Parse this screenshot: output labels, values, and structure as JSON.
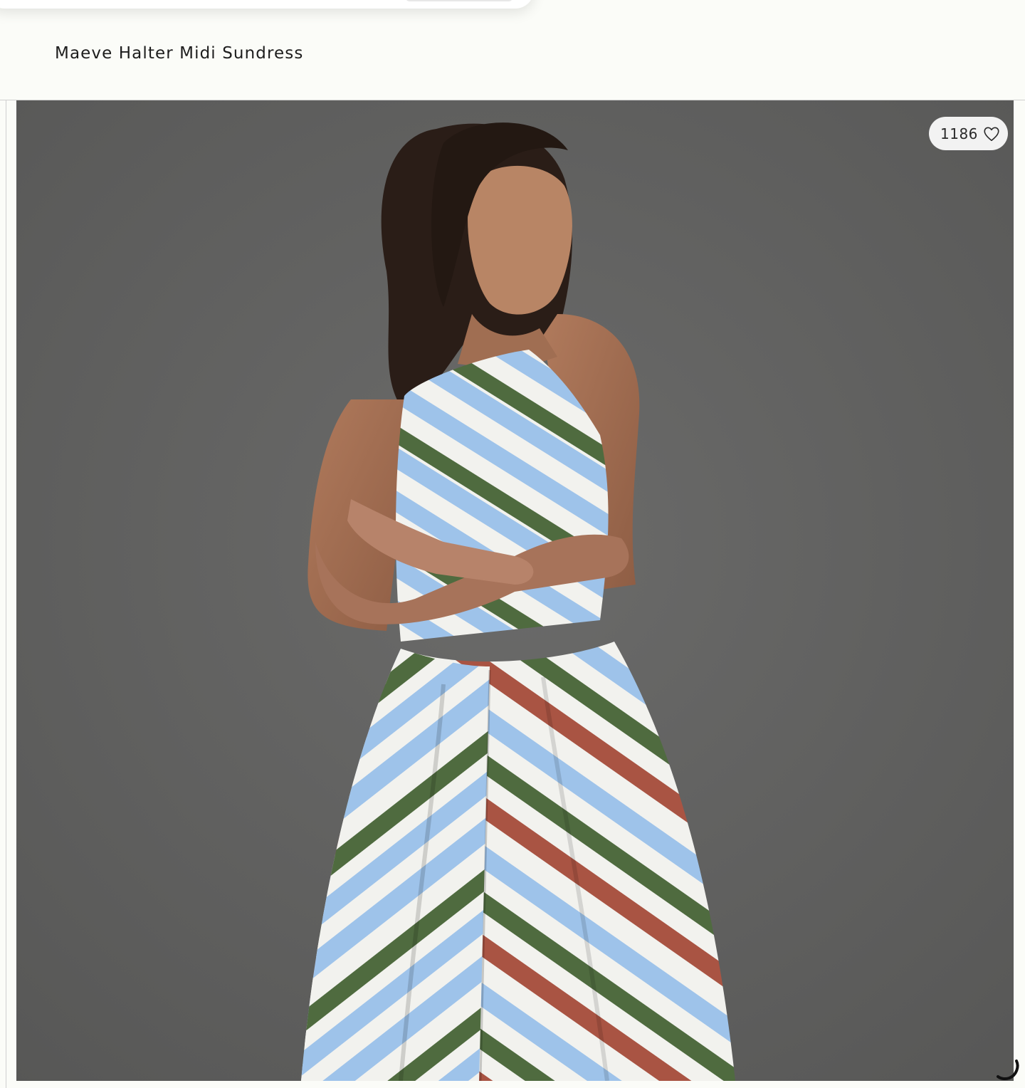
{
  "header": {
    "product_title": "Maeve Halter Midi Sundress"
  },
  "product_image": {
    "alt": "Model wearing striped halter midi sundress",
    "like_count": "1186"
  },
  "icons": {
    "like": "heart-outline-icon",
    "loading": "loading-spinner-icon"
  },
  "colors": {
    "page_background": "#fbfcf8",
    "photo_background": "#5f5f5e",
    "stripe_blue": "#9ec3ea",
    "stripe_white": "#f2f2ee",
    "stripe_green": "#4f6b3f",
    "stripe_red": "#a95443"
  }
}
